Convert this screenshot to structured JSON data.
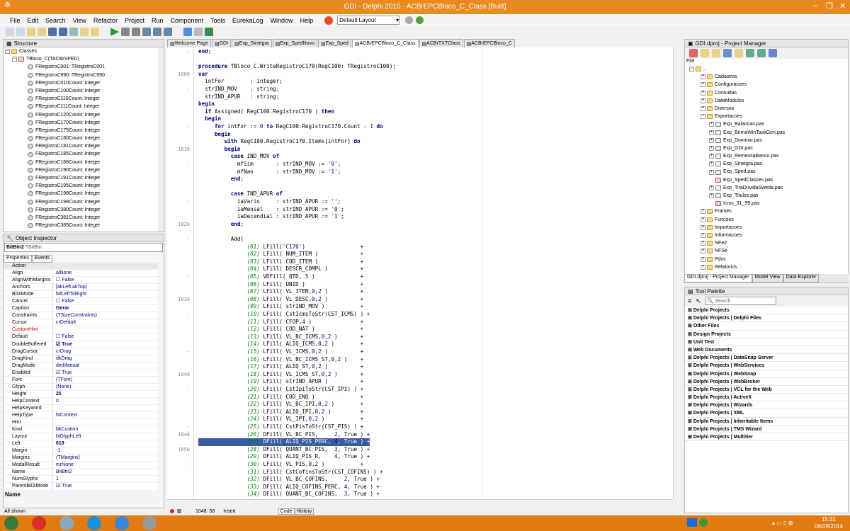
{
  "window": {
    "title": "GDI - Delphi 2010 - ACBrEPCBloco_C_Class [Built]"
  },
  "menu": [
    "File",
    "Edit",
    "Search",
    "View",
    "Refactor",
    "Project",
    "Run",
    "Component",
    "Tools",
    "EurekaLog",
    "Window",
    "Help"
  ],
  "layout_combo": "Default Layout",
  "structure": {
    "title": "Structure",
    "root": "Classes",
    "class": "TBloco_C(TACBrSPED)",
    "items": [
      "FRegistroC001: TRegistroC001",
      "FRegistroC990: TRegistroC990",
      "FRegistroC010Count: Integer",
      "FRegistroC100Count: Integer",
      "FRegistroC110Count: Integer",
      "FRegistroC111Count: Integer",
      "FRegistroC120Count: Integer",
      "FRegistroC170Count: Integer",
      "FRegistroC175Count: Integer",
      "FRegistroC180Count: Integer",
      "FRegistroC181Count: Integer",
      "FRegistroC185Count: Integer",
      "FRegistroC188Count: Integer",
      "FRegistroC190Count: Integer",
      "FRegistroC191Count: Integer",
      "FRegistroC195Count: Integer",
      "FRegistroC198Count: Integer",
      "FRegistroC199Count: Integer",
      "FRegistroC380Count: Integer",
      "FRegistroC381Count: Integer",
      "FRegistroC385Count: Integer"
    ]
  },
  "inspector": {
    "title": "Object Inspector",
    "object": "BitBtn2",
    "object_type": "TBitBtn",
    "tab_properties": "Properties",
    "tab_events": "Events",
    "footer": "Name",
    "status": "All shown",
    "props": [
      [
        "Action",
        ""
      ],
      [
        "Align",
        "alNone"
      ],
      [
        "AlignWithMargins",
        "False"
      ],
      [
        "Anchors",
        "[akLeft,akTop]"
      ],
      [
        "BiDiMode",
        "bdLeftToRight"
      ],
      [
        "Cancel",
        "False"
      ],
      [
        "Caption",
        "Gerar"
      ],
      [
        "Constraints",
        "(TSizeConstraints)"
      ],
      [
        "Cursor",
        "crDefault"
      ],
      [
        "CustomHint",
        ""
      ],
      [
        "Default",
        "False"
      ],
      [
        "DoubleBuffered",
        "True"
      ],
      [
        "DragCursor",
        "crDrag"
      ],
      [
        "DragKind",
        "dkDrag"
      ],
      [
        "DragMode",
        "dmManual"
      ],
      [
        "Enabled",
        "True"
      ],
      [
        "Font",
        "(TFont)"
      ],
      [
        "Glyph",
        "(None)"
      ],
      [
        "Height",
        "25"
      ],
      [
        "HelpContext",
        "0"
      ],
      [
        "HelpKeyword",
        ""
      ],
      [
        "HelpType",
        "htContext"
      ],
      [
        "Hint",
        ""
      ],
      [
        "Kind",
        "bkCustom"
      ],
      [
        "Layout",
        "blGlyphLeft"
      ],
      [
        "Left",
        "619"
      ],
      [
        "Margin",
        "-1"
      ],
      [
        "Margins",
        "(TMargins)"
      ],
      [
        "ModalResult",
        "mrNone"
      ],
      [
        "Name",
        "BitBtn2"
      ],
      [
        "NumGlyphs",
        "1"
      ],
      [
        "ParentBiDiMode",
        "True"
      ]
    ]
  },
  "tabs": [
    "Welcome Page",
    "GDI",
    "Exp_Sintegra",
    "Exp_SpedNovo",
    "Exp_Sped",
    "ACBrEPCBloco_C_Class",
    "ACBrTXTClass",
    "ACBrEPCBloco_C"
  ],
  "code": [
    {
      "ln": "",
      "t": "end;"
    },
    {
      "ln": "",
      "t": ""
    },
    {
      "ln": "",
      "t": "procedure TBloco_C.WriteRegistroC170(RegC100: TRegistroC100);"
    },
    {
      "ln": "1000",
      "t": "var"
    },
    {
      "ln": "",
      "t": "  intFor        : integer;"
    },
    {
      "ln": "",
      "t": "  strIND_MOV    : string;"
    },
    {
      "ln": "",
      "t": "  strIND_APUR   : string;"
    },
    {
      "ln": "",
      "t": "begin"
    },
    {
      "ln": "",
      "t": "  if Assigned( RegC100.RegistroC170 ) then"
    },
    {
      "ln": "",
      "t": "  begin"
    },
    {
      "ln": "",
      "t": "     for intFor := 0 to RegC100.RegistroC170.Count - 1 do"
    },
    {
      "ln": "",
      "t": "     begin"
    },
    {
      "ln": "",
      "t": "        with RegC100.RegistroC170.Items[intFor] do"
    },
    {
      "ln": "1010",
      "t": "        begin"
    },
    {
      "ln": "",
      "t": "          case IND_MOV of"
    },
    {
      "ln": "",
      "t": "            mfSim       : strIND_MOV := '0';"
    },
    {
      "ln": "",
      "t": "            mfNao       : strIND_MOV := '1';"
    },
    {
      "ln": "",
      "t": "          end;"
    },
    {
      "ln": "",
      "t": ""
    },
    {
      "ln": "",
      "t": "          case IND_APUR of"
    },
    {
      "ln": "",
      "t": "            iaVario     : strIND_APUR := '';"
    },
    {
      "ln": "",
      "t": "            iaMensal    : strIND_APUR := '0';"
    },
    {
      "ln": "",
      "t": "            iaDecendial : strIND_APUR := '1';"
    },
    {
      "ln": "1020",
      "t": "          end;"
    },
    {
      "ln": "",
      "t": ""
    },
    {
      "ln": "",
      "t": "          Add("
    },
    {
      "ln": "",
      "t": "               (01) LFill('C170')                 +"
    },
    {
      "ln": "",
      "t": "               (02) LFill( NUM_ITEM )             +"
    },
    {
      "ln": "",
      "t": "               (03) LFill( COD_ITEM )             +"
    },
    {
      "ln": "",
      "t": "               (04) LFill( DESCR_COMPL )          +"
    },
    {
      "ln": "",
      "t": "               (05) VDFill( QTD, 5 )              +"
    },
    {
      "ln": "",
      "t": "               (06) LFill( UNID )                 +"
    },
    {
      "ln": "",
      "t": "               (07) LFill( VL_ITEM,0,2 )          +"
    },
    {
      "ln": "1030",
      "t": "               (08) LFill( VL_DESC,0,2 )          +"
    },
    {
      "ln": "",
      "t": "               (09) LFill( strIND_MOV )           +"
    },
    {
      "ln": "",
      "t": "               (10) LFill( CstIcmsToStr(CST_ICMS) ) +"
    },
    {
      "ln": "",
      "t": "               (11) LFill( CFOP,4 )               +"
    },
    {
      "ln": "",
      "t": "               (12) LFill( COD_NAT )              +"
    },
    {
      "ln": "",
      "t": "               (13) LFill( VL_BC_ICMS,0,2 )       +"
    },
    {
      "ln": "",
      "t": "               (14) LFill( ALIQ_ICMS,0,2 )        +"
    },
    {
      "ln": "",
      "t": "               (15) LFill( VL_ICMS,0,2 )          +"
    },
    {
      "ln": "",
      "t": "               (16) LFill( VL_BC_ICMS_ST,0,2 )    +"
    },
    {
      "ln": "",
      "t": "               (17) LFill( ALIQ_ST,0,2 )          +"
    },
    {
      "ln": "1040",
      "t": "               (18) LFill( VL_ICMS_ST,0,2 )       +"
    },
    {
      "ln": "",
      "t": "               (19) LFill( strIND_APUR )          +"
    },
    {
      "ln": "",
      "t": "               (20) LFill( CstIpiToStr(CST_IPI) ) +"
    },
    {
      "ln": "",
      "t": "               (21) LFill( COD_ENQ )              +"
    },
    {
      "ln": "",
      "t": "               (22) LFill( VL_BC_IPI,0,2 )        +"
    },
    {
      "ln": "",
      "t": "               (23) LFill( ALIQ_IPI,0,2 )         +"
    },
    {
      "ln": "",
      "t": "               (24) LFill( VL_IPI,0,2 )           +"
    },
    {
      "ln": "",
      "t": "               (25) LFill( CstPisToStr(CST_PIS) ) +"
    },
    {
      "ln": "1048",
      "t": "               (26) DFill( VL_BC_PIS,     2, True ) +"
    },
    {
      "ln": "",
      "t": "               (27) DFill( ALIQ_PIS_PERC, 4, True ) +"
    },
    {
      "ln": "1050",
      "t": "               (28) DFill( QUANT_BC_PIS,  3, True ) +"
    },
    {
      "ln": "",
      "t": "               (29) DFill( ALIQ_PIS_R,    4, True ) +"
    },
    {
      "ln": "",
      "t": "               (30) LFill( VL_PIS,0,2 )           +"
    },
    {
      "ln": "",
      "t": "               (31) LFill( CstCofinsToStr(CST_COFINS) ) +"
    },
    {
      "ln": "",
      "t": "               (32) DFill( VL_BC_COFINS,     2, True ) +"
    },
    {
      "ln": "",
      "t": "               (33) DFill( ALIQ_COFINS_PERC, 4, True ) +"
    },
    {
      "ln": "",
      "t": "               (34) DFill( QUANT_BC_COFINS,  3, True ) +"
    }
  ],
  "highlight_line": 52,
  "editor_status": {
    "pos": "1048: 58",
    "mode": "Insert",
    "tab_code": "Code",
    "tab_history": "History"
  },
  "project_manager": {
    "title": "GDI.dproj - Project Manager",
    "file_label": "File",
    "root": "..",
    "items": [
      [
        "Cadastros",
        "f",
        1
      ],
      [
        "Configuracoes",
        "f",
        1
      ],
      [
        "Consultas",
        "f",
        1
      ],
      [
        "DataModulos",
        "f",
        1
      ],
      [
        "Diversos",
        "f",
        1
      ],
      [
        "Exportacoes",
        "f",
        1
      ],
      [
        "Exp_Balancas.pas",
        "u",
        2
      ],
      [
        "Exp_BemaWinTaskGen.pas",
        "u",
        2
      ],
      [
        "Exp_Dominio.pas",
        "u",
        2
      ],
      [
        "Exp_GDI.pas",
        "u",
        2
      ],
      [
        "Exp_RemessaBanco.pas",
        "u",
        2
      ],
      [
        "Exp_Sintegra.pas",
        "u",
        2
      ],
      [
        "Exp_Sped.pas",
        "u",
        2
      ],
      [
        "Exp_SpedClasses.pas",
        "x",
        2
      ],
      [
        "Exp_TiraDuvidaSweda.pas",
        "u",
        2
      ],
      [
        "Exp_Titulos.pas",
        "u",
        2
      ],
      [
        "Icms_31_99.pas",
        "x",
        2
      ],
      [
        "Frames",
        "f",
        1
      ],
      [
        "Funcoes",
        "f",
        1
      ],
      [
        "Importacoes",
        "f",
        1
      ],
      [
        "Informacoes",
        "f",
        1
      ],
      [
        "NFe2",
        "f",
        1
      ],
      [
        "NFSe",
        "f",
        1
      ],
      [
        "Pdvs",
        "f",
        1
      ],
      [
        "Relatorios",
        "f",
        1
      ]
    ],
    "bottom_tabs": [
      "GDI.dproj - Project Manager",
      "Model View",
      "Data Explorer"
    ]
  },
  "tool_palette": {
    "title": "Tool Palette",
    "search": "Search",
    "categories": [
      "Delphi Projects",
      "Delphi Projects | Delphi Files",
      "Other Files",
      "Design Projects",
      "Unit Test",
      "Web Documents",
      "Delphi Projects | DataSnap Server",
      "Delphi Projects | WebServices",
      "Delphi Projects | WebSnap",
      "Delphi Projects | WebBroker",
      "Delphi Projects | VCL for the Web",
      "Delphi Projects | ActiveX",
      "Delphi Projects | Wizards",
      "Delphi Projects | XML",
      "Delphi Projects | Inheritable Items",
      "Delphi Projects | TMS Wizard",
      "Delphi Projects | Multitier"
    ]
  },
  "clock": {
    "time": "15:31",
    "date": "08/09/2014"
  }
}
